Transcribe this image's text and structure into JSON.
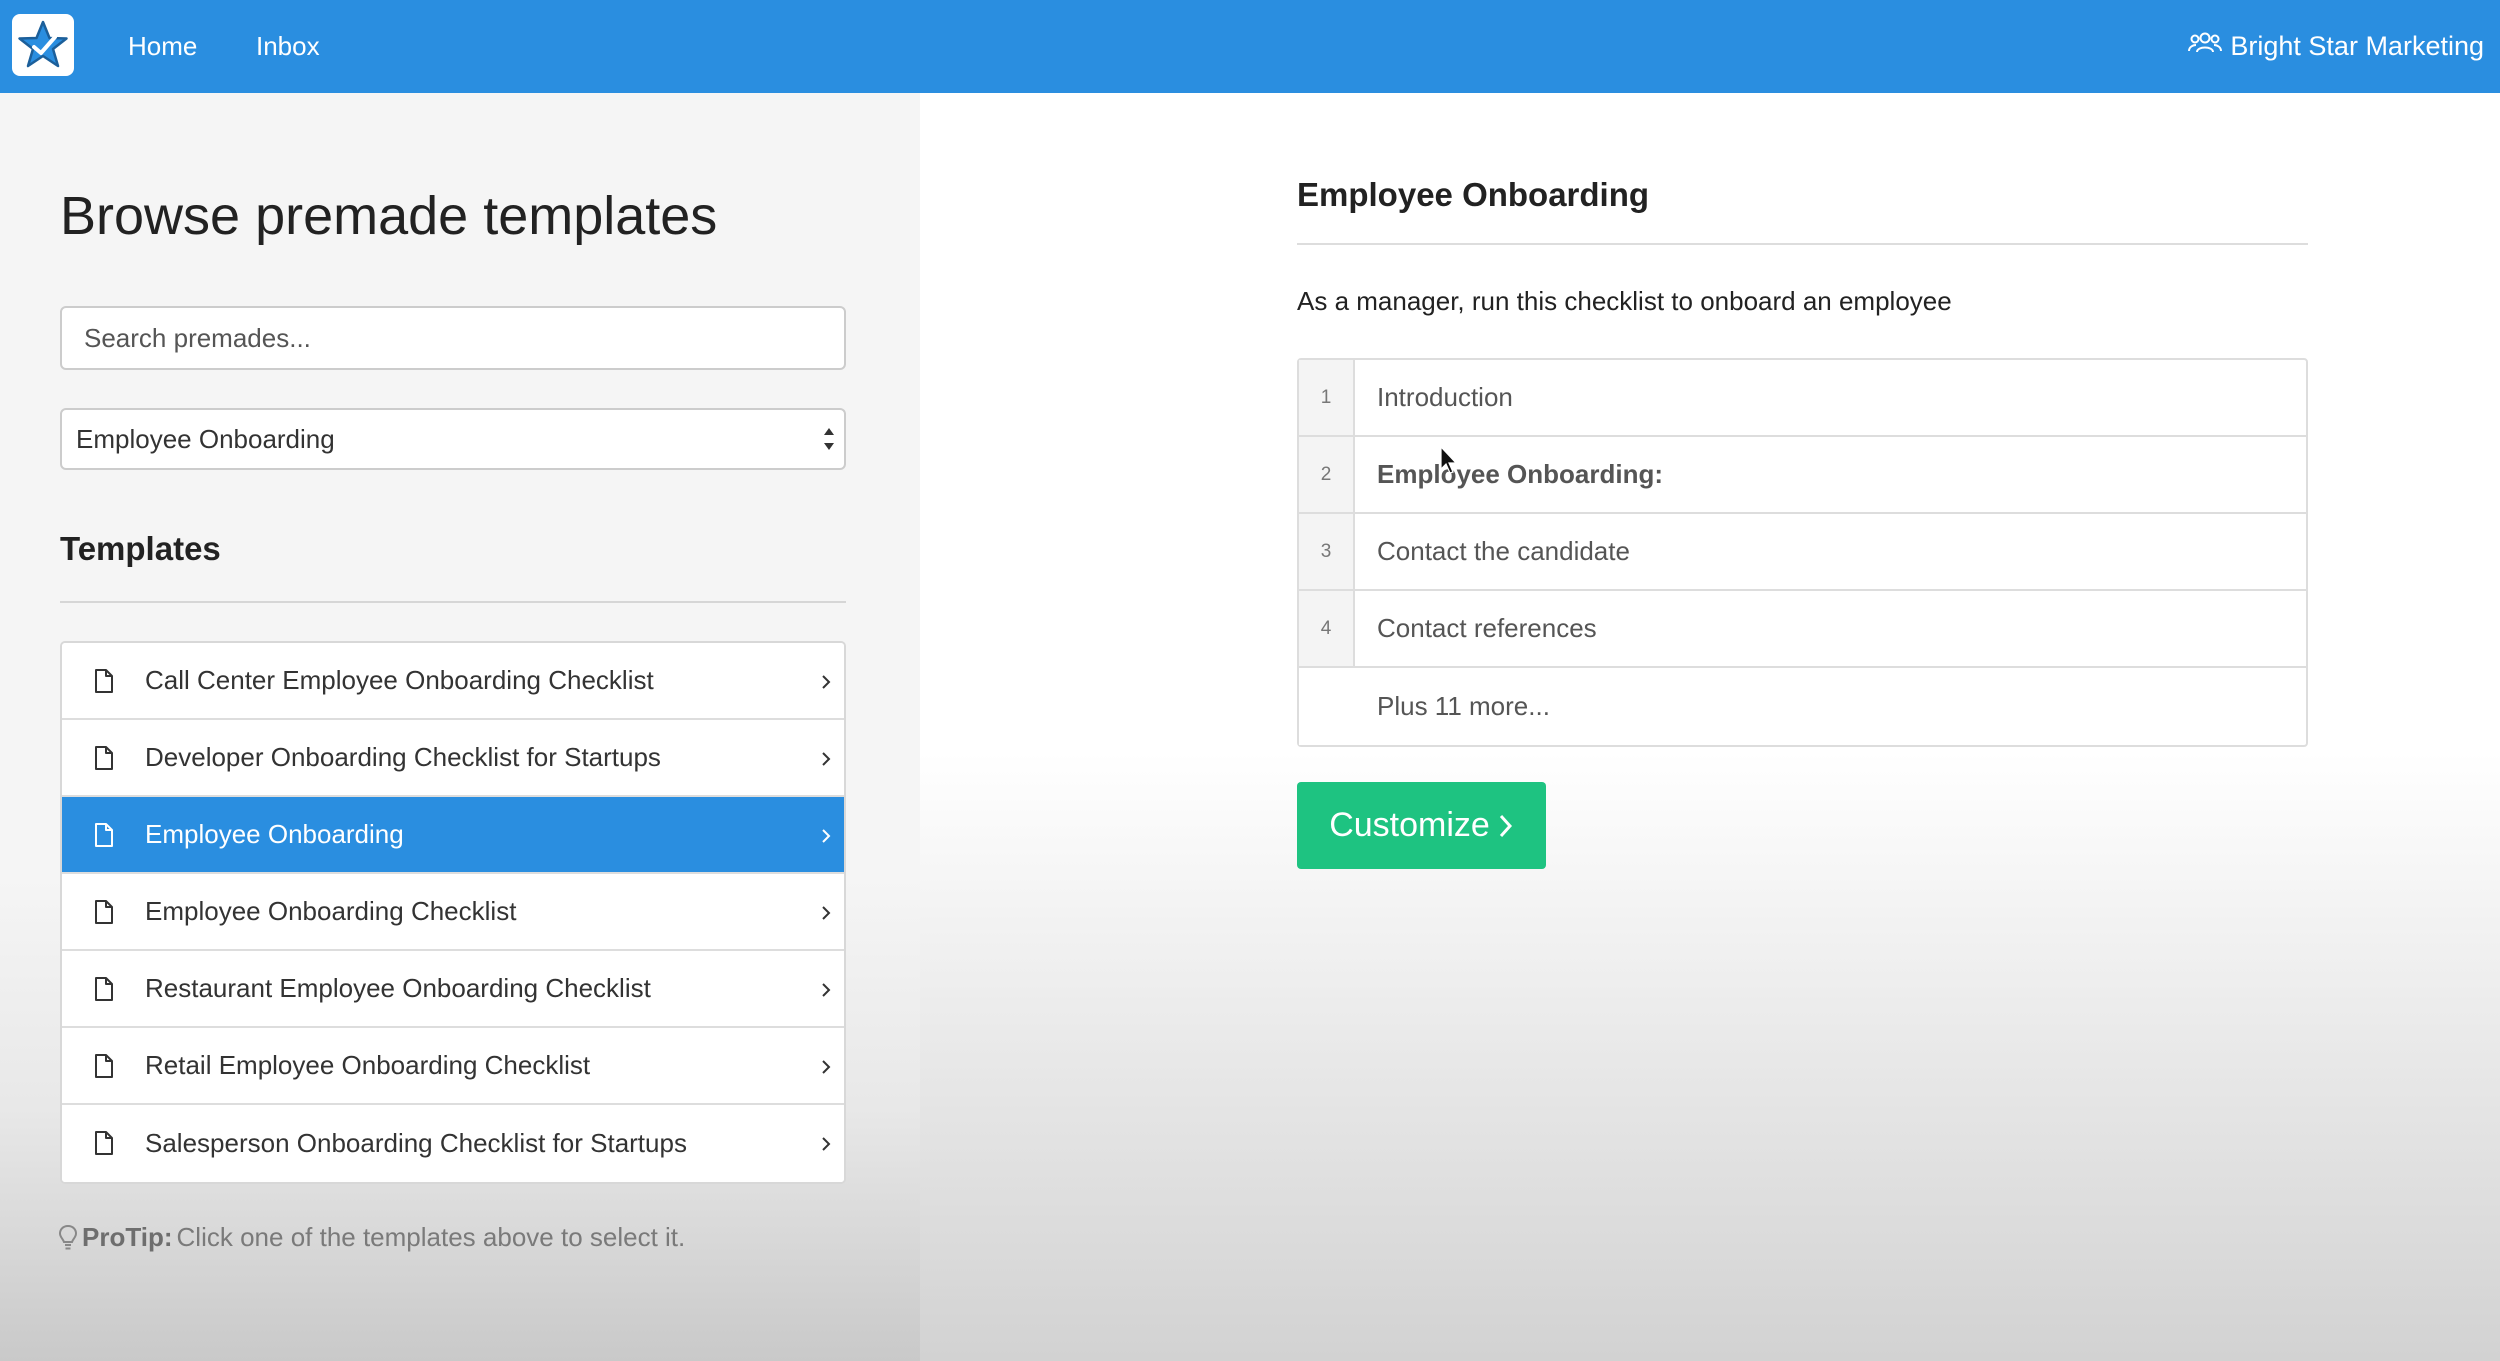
{
  "nav": {
    "logo": "star-logo",
    "links": [
      {
        "label": "Home"
      },
      {
        "label": "Inbox"
      }
    ],
    "organization": "Bright Star Marketing"
  },
  "sidebar": {
    "title": "Browse premade templates",
    "search": {
      "placeholder": "Search premades...",
      "value": ""
    },
    "category_select": {
      "selected": "Employee Onboarding"
    },
    "section_title": "Templates",
    "templates": [
      {
        "label": "Call Center Employee Onboarding Checklist",
        "active": false
      },
      {
        "label": "Developer Onboarding Checklist for Startups",
        "active": false
      },
      {
        "label": "Employee Onboarding",
        "active": true
      },
      {
        "label": "Employee Onboarding Checklist",
        "active": false
      },
      {
        "label": "Restaurant Employee Onboarding Checklist",
        "active": false
      },
      {
        "label": "Retail Employee Onboarding Checklist",
        "active": false
      },
      {
        "label": "Salesperson Onboarding Checklist for Startups",
        "active": false
      }
    ],
    "protip": {
      "label": "ProTip:",
      "text": "Click one of the templates above to select it."
    }
  },
  "detail": {
    "title": "Employee Onboarding",
    "description": "As a manager, run this checklist to onboard an employee",
    "steps": [
      {
        "num": "1",
        "text": "Introduction",
        "bold": false
      },
      {
        "num": "2",
        "text": "Employee Onboarding:",
        "bold": true
      },
      {
        "num": "3",
        "text": "Contact the candidate",
        "bold": false
      },
      {
        "num": "4",
        "text": "Contact references",
        "bold": false
      }
    ],
    "more_text": "Plus 11 more...",
    "customize_label": "Customize"
  },
  "colors": {
    "nav_blue": "#2a8ee0",
    "active_item": "#2a8ee0",
    "customize_green": "#1ec381"
  }
}
